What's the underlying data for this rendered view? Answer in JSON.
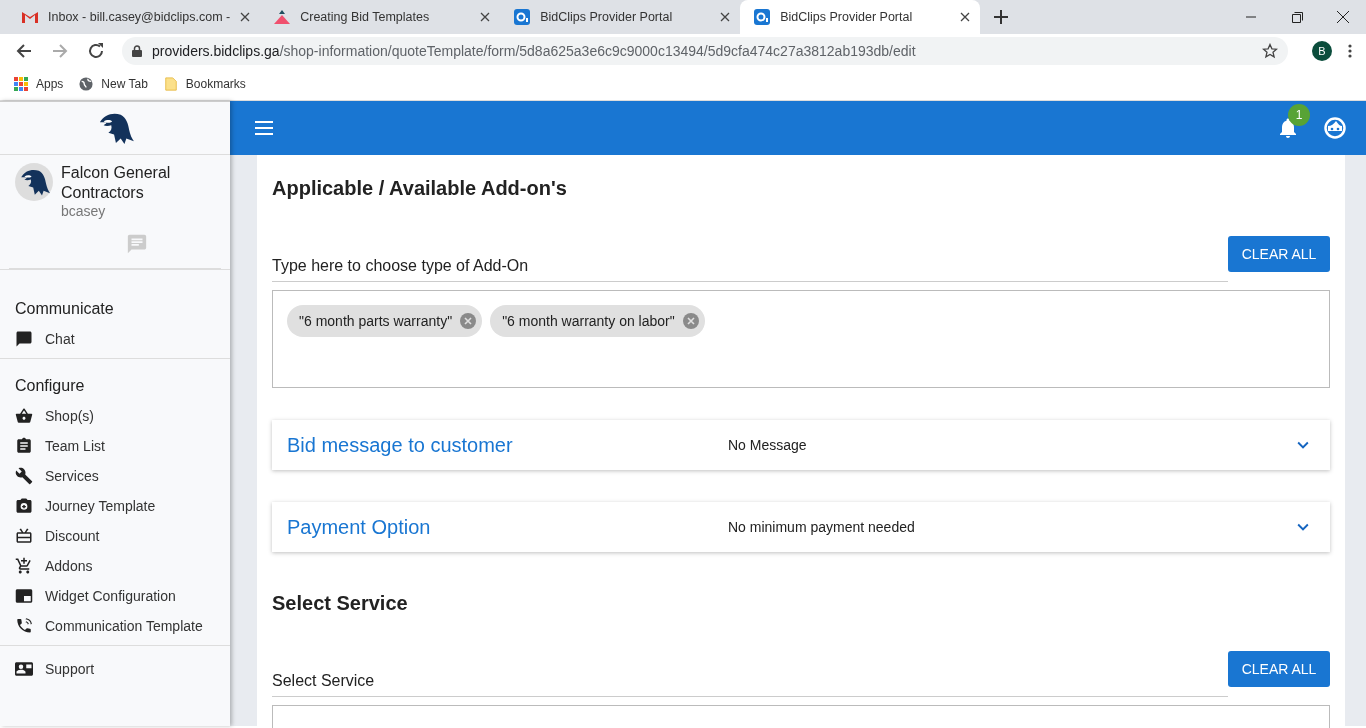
{
  "browser": {
    "tabs": [
      {
        "title": "Inbox - bill.casey@bidclips.com -",
        "kind": "mail",
        "selected": false
      },
      {
        "title": "Creating Bid Templates",
        "kind": "triangle",
        "selected": false
      },
      {
        "title": "BidClips Provider Portal",
        "kind": "portal",
        "selected": false
      },
      {
        "title": "BidClips Provider Portal",
        "kind": "portal",
        "selected": true
      }
    ],
    "url": {
      "host": "providers.bidclips.ga",
      "path": "/shop-information/quoteTemplate/form/5d8a625a3e6c9c9000c13494/5d9cfa474c27a3812ab193db/edit"
    },
    "bookmarks": [
      {
        "label": "Apps",
        "kind": "apps"
      },
      {
        "label": "New Tab",
        "kind": "globe"
      },
      {
        "label": "Bookmarks",
        "kind": "folder"
      }
    ],
    "profile_initial": "B"
  },
  "sidebar": {
    "company": "Falcon General Contractors",
    "username": "bcasey",
    "sections": [
      {
        "title": "Communicate",
        "items": [
          {
            "label": "Chat",
            "kind": "chat"
          }
        ]
      },
      {
        "title": "Configure",
        "items": [
          {
            "label": "Shop(s)",
            "kind": "basket"
          },
          {
            "label": "Team List",
            "kind": "clipboard"
          },
          {
            "label": "Services",
            "kind": "wrench"
          },
          {
            "label": "Journey Template",
            "kind": "camera"
          },
          {
            "label": "Discount",
            "kind": "gift"
          },
          {
            "label": "Addons",
            "kind": "cart"
          },
          {
            "label": "Widget Configuration",
            "kind": "widget"
          },
          {
            "label": "Communication Template",
            "kind": "phone"
          }
        ]
      },
      {
        "items": [
          {
            "label": "Support",
            "kind": "card"
          }
        ]
      }
    ]
  },
  "topbar": {
    "notification_count": "1"
  },
  "addons": {
    "title": "Applicable / Available Add-on's",
    "placeholder": "Type here to choose type of Add-On",
    "button": "CLEAR ALL",
    "chips": [
      "\"6 month parts warranty\"",
      "\"6 month warranty on labor\""
    ]
  },
  "panels": [
    {
      "title": "Bid message to customer",
      "summary": "No Message",
      "expanded": false
    },
    {
      "title": "Payment Option",
      "summary": "No minimum payment needed",
      "expanded": false
    }
  ],
  "service": {
    "title": "Select Service",
    "placeholder": "Select Service",
    "button": "CLEAR ALL"
  }
}
